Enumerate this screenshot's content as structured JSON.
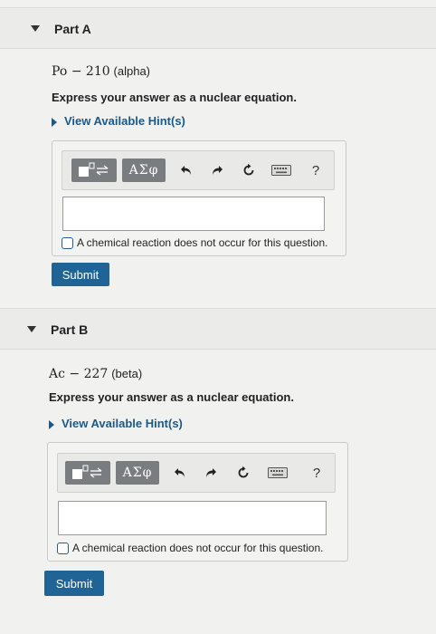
{
  "parts": [
    {
      "title": "Part A",
      "isotope": "Po − 210",
      "decay": "(alpha)",
      "instruction": "Express your answer as a nuclear equation.",
      "hint_label": "View Available Hint(s)",
      "toolbar": {
        "template_icon": "template-icon",
        "greek_label": "ΑΣφ",
        "undo_icon": "undo-icon",
        "redo_icon": "redo-icon",
        "reset_icon": "reset-icon",
        "keyboard_icon": "keyboard-icon",
        "help_label": "?"
      },
      "answer_value": "",
      "no_reaction_label": "A chemical reaction does not occur for this question.",
      "submit_label": "Submit"
    },
    {
      "title": "Part B",
      "isotope": "Ac − 227",
      "decay": "(beta)",
      "instruction": "Express your answer as a nuclear equation.",
      "hint_label": "View Available Hint(s)",
      "toolbar": {
        "template_icon": "template-icon",
        "greek_label": "ΑΣφ",
        "undo_icon": "undo-icon",
        "redo_icon": "redo-icon",
        "reset_icon": "reset-icon",
        "keyboard_icon": "keyboard-icon",
        "help_label": "?"
      },
      "answer_value": "",
      "no_reaction_label": "A chemical reaction does not occur for this question.",
      "submit_label": "Submit"
    }
  ]
}
